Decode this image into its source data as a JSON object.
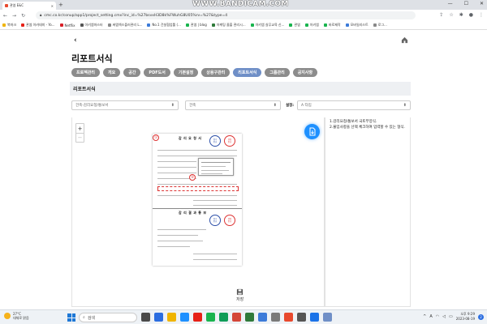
{
  "browser": {
    "tab_title": "관엽 E&C",
    "watermark": "WWW.BANDICAM.COM",
    "url": "cmc.co.kr/conup/app1/project_setting.cmx?inc_id=%27bsvxH3D8k%FWuhG8U05%rv=%27&type=4",
    "bookmarks": [
      {
        "label": "북마크",
        "color": "#f0b400"
      },
      {
        "label": "관엽 아카데미 - Yo...",
        "color": "#e62117"
      },
      {
        "label": "Netflix",
        "color": "#d81f26"
      },
      {
        "label": "아키엠마스터",
        "color": "#555555"
      },
      {
        "label": "써엠엑스플러관리 L...",
        "color": "#8a8a8a"
      },
      {
        "label": "No.1 건설협업툴 (...",
        "color": "#3c7bd9"
      },
      {
        "label": "관엽 | blog",
        "color": "#19b44e"
      },
      {
        "label": "아케팅 졸출 관리시...",
        "color": "#2f7a3a"
      },
      {
        "label": "아키엠 실무교육 신...",
        "color": "#19b44e"
      },
      {
        "label": "관엽",
        "color": "#19b44e"
      },
      {
        "label": "아키엠",
        "color": "#19b44e"
      },
      {
        "label": "바로제작",
        "color": "#19b44e"
      },
      {
        "label": "모바일리스트",
        "color": "#3c7bd9"
      },
      {
        "label": "로그...",
        "color": "#888888"
      }
    ]
  },
  "page": {
    "title": "리포트서식",
    "section_title": "리포트서식",
    "tabs": [
      {
        "label": "프로젝관리",
        "active": false
      },
      {
        "label": "개요",
        "active": false
      },
      {
        "label": "공간",
        "active": false
      },
      {
        "label": "PDF도서",
        "active": false
      },
      {
        "label": "기본설정",
        "active": false
      },
      {
        "label": "상용구관리",
        "active": false
      },
      {
        "label": "리포트서식",
        "active": true
      },
      {
        "label": "그룹관리",
        "active": false
      },
      {
        "label": "공지사항",
        "active": false
      }
    ],
    "filters": {
      "category": "건축-감리요청/통보서",
      "discipline": "건축",
      "setting_label": "설정:",
      "type": "A 타입"
    },
    "notes": [
      "1.감리요청/통보서 국토부양식.",
      "2.불임사항을 선택 체크하여 입력할 수 있는 형식."
    ],
    "zoom": {
      "plus": "+",
      "minus": "−"
    },
    "save_label": "저장"
  },
  "document": {
    "title_top": "감 리 요 청 서",
    "title_bottom": "감 리 결 과 통 보",
    "marker_1": "①",
    "marker_2": "②",
    "stamp_1": {
      "top": "접수",
      "bottom": "번호"
    },
    "stamp_2": {
      "top": "결정",
      "bottom": "번호"
    },
    "stamp_3": {
      "top": "접수",
      "bottom": "번호"
    },
    "stamp_4": {
      "top": "결정",
      "bottom": "번호"
    }
  },
  "taskbar": {
    "temperature": "27°C",
    "weather": "대체로 맑음",
    "search_placeholder": "검색",
    "lang": "A",
    "time": "오후 9:29",
    "date": "2023-08-19",
    "notifications": "2"
  }
}
